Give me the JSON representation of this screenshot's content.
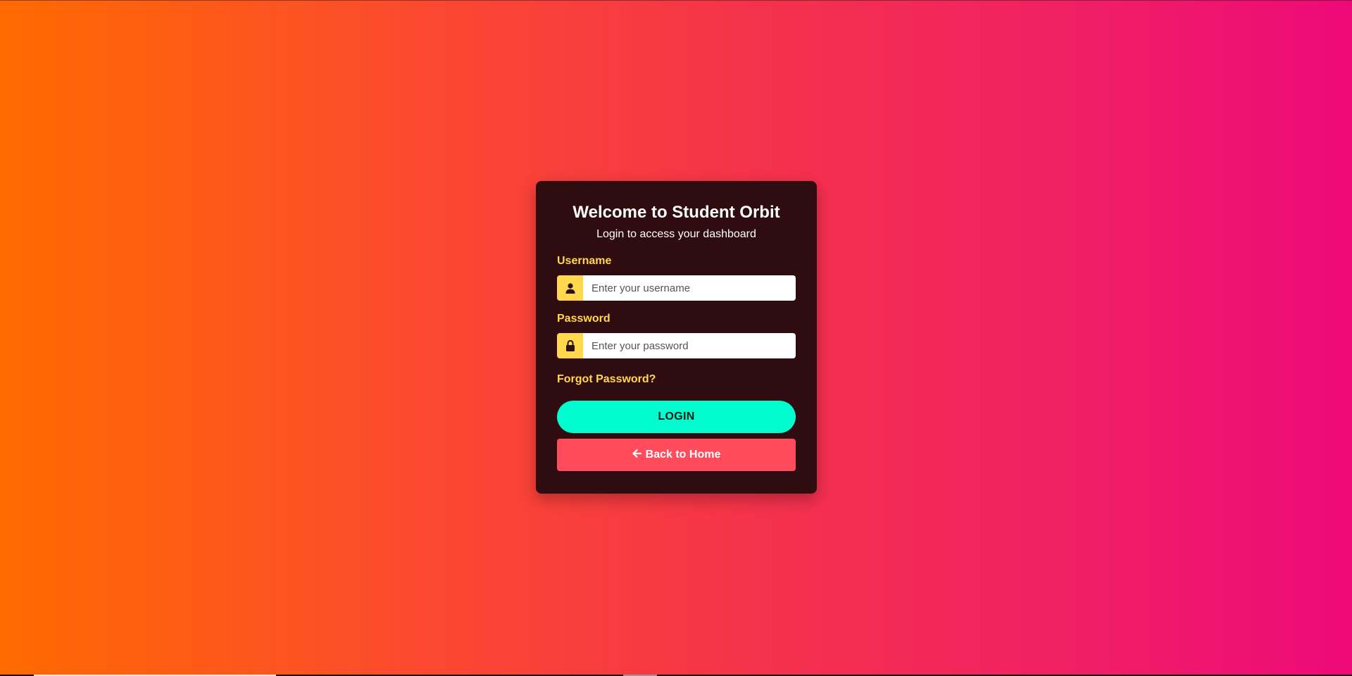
{
  "page": {
    "background_gradient": [
      "#ff6a00",
      "#ee0979"
    ]
  },
  "card": {
    "title": "Welcome to Student Orbit",
    "subtitle": "Login to access your dashboard",
    "background": "#2f0c10"
  },
  "form": {
    "username": {
      "label": "Username",
      "placeholder": "Enter your username",
      "value": "",
      "icon": "user-icon"
    },
    "password": {
      "label": "Password",
      "placeholder": "Enter your password",
      "value": "",
      "icon": "lock-icon"
    },
    "forgot_link": "Forgot Password?",
    "login_button": "LOGIN",
    "back_button": "Back to Home",
    "back_icon": "arrow-left-icon"
  },
  "colors": {
    "accent_yellow": "#ffd84d",
    "login_button": "#00fccf",
    "back_button": "#ff4b5c"
  }
}
